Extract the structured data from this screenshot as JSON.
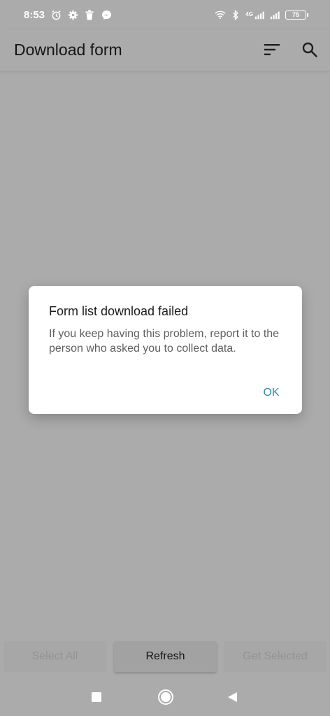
{
  "status_bar": {
    "time": "8:53",
    "network_label": "4G",
    "battery_level": "75",
    "icons": [
      "alarm-icon",
      "gear-icon",
      "trash-icon",
      "messenger-icon",
      "wifi-icon",
      "bluetooth-icon",
      "signal-icon",
      "signal-icon",
      "battery-icon"
    ]
  },
  "app_bar": {
    "title": "Download form",
    "actions": [
      "sort-icon",
      "search-icon"
    ]
  },
  "dialog": {
    "title": "Form list download failed",
    "message": "If you keep having this problem, report it to the person who asked you to collect data.",
    "ok_label": "OK",
    "accent_color": "#2f8aa1"
  },
  "bottom_buttons": {
    "select_all": "Select All",
    "refresh": "Refresh",
    "get_selected": "Get Selected"
  },
  "nav_bar": {
    "icons": [
      "recents-icon",
      "home-icon",
      "back-icon"
    ]
  },
  "colors": {
    "scrim_background": "#ababab",
    "status_text": "#ffffff",
    "dialog_background": "#ffffff"
  }
}
